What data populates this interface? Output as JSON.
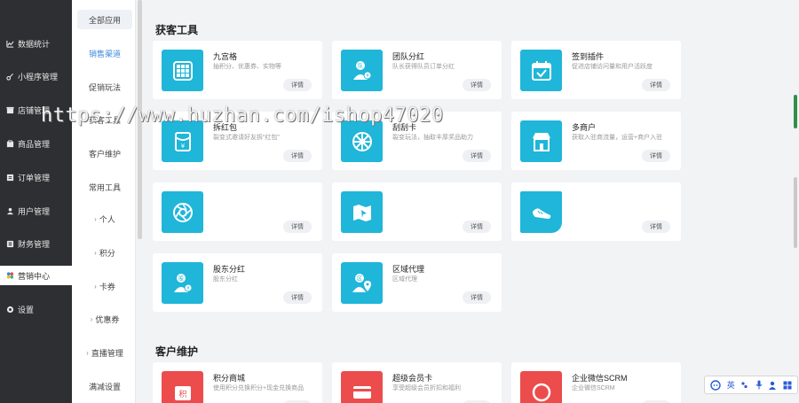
{
  "sidebar": {
    "items": [
      {
        "icon": "chart-icon",
        "glyph": "📈",
        "label": "数据统计"
      },
      {
        "icon": "link-icon",
        "glyph": "⚲",
        "label": "小程序管理"
      },
      {
        "icon": "store-icon",
        "glyph": "▣",
        "label": "店铺管理"
      },
      {
        "icon": "goods-icon",
        "glyph": "▤",
        "label": "商品管理"
      },
      {
        "icon": "order-icon",
        "glyph": "▥",
        "label": "订单管理"
      },
      {
        "icon": "user-icon",
        "glyph": "●",
        "label": "用户管理"
      },
      {
        "icon": "finance-icon",
        "glyph": "▦",
        "label": "财务管理"
      },
      {
        "icon": "marketing-icon",
        "glyph": "✿",
        "label": "营销中心"
      },
      {
        "icon": "settings-icon",
        "glyph": "◉",
        "label": "设置"
      }
    ]
  },
  "subnav": {
    "items": [
      {
        "label": "全部应用",
        "arrow": false
      },
      {
        "label": "销售渠道",
        "arrow": false
      },
      {
        "label": "促销玩法",
        "arrow": false
      },
      {
        "label": "获客工具",
        "arrow": false
      },
      {
        "label": "客户维护",
        "arrow": false
      },
      {
        "label": "常用工具",
        "arrow": false
      },
      {
        "label": "个人",
        "arrow": true
      },
      {
        "label": "积分",
        "arrow": true
      },
      {
        "label": "卡券",
        "arrow": true
      },
      {
        "label": "优惠券",
        "arrow": true
      },
      {
        "label": "直播管理",
        "arrow": true
      },
      {
        "label": "满减设置",
        "arrow": false
      }
    ]
  },
  "sections": [
    {
      "title": "获客工具",
      "cards": [
        {
          "name": "九宫格",
          "desc": "抽积分、优惠券、实物等",
          "button": "详情",
          "icon": "grid-icon"
        },
        {
          "name": "团队分红",
          "desc": "队长获得队员订单分红",
          "button": "详情",
          "icon": "team-bonus-icon"
        },
        {
          "name": "签到插件",
          "desc": "促进店铺访问量和用户活跃度",
          "button": "详情",
          "icon": "calendar-check-icon"
        },
        {
          "name": "拆红包",
          "desc": "裂变式邀请好友拆“红包”",
          "button": "详情",
          "icon": "red-packet-icon"
        },
        {
          "name": "刮刮卡",
          "desc": "裂变玩法，抽取丰厚奖品助力",
          "button": "详情",
          "icon": "wheel-icon"
        },
        {
          "name": "多商户",
          "desc": "获取入驻商流量，运营+商户入驻",
          "button": "详情",
          "icon": "shop-icon"
        },
        {
          "name": "",
          "desc": "",
          "button": "详情",
          "icon": "aperture-icon"
        },
        {
          "name": "",
          "desc": "",
          "button": "详情",
          "icon": "map-icon"
        },
        {
          "name": "",
          "desc": "",
          "button": "详情",
          "icon": "shoe-icon"
        },
        {
          "name": "股东分红",
          "desc": "股东分红",
          "button": "详情",
          "icon": "shareholder-icon"
        },
        {
          "name": "区域代理",
          "desc": "区域代理",
          "button": "详情",
          "icon": "location-agent-icon"
        }
      ]
    },
    {
      "title": "客户维护",
      "cards": [
        {
          "name": "积分商城",
          "desc": "使用积分兑换积分+现金兑换商品",
          "button": "详情",
          "icon": "points-mall-icon"
        },
        {
          "name": "超级会员卡",
          "desc": "享受超级会员折扣和福利",
          "button": "详情",
          "icon": "vip-card-icon"
        },
        {
          "name": "企业微信SCRM",
          "desc": "企业微信SCRM",
          "button": "详情",
          "icon": "scrm-icon"
        }
      ]
    }
  ],
  "watermark": "https://www.huzhan.com/ishop47020",
  "ime": {
    "lang": "英"
  },
  "colors": {
    "sidebar_bg": "#2e2f32",
    "tile_blue": "#1fb6d9",
    "tile_red": "#ec4c4c",
    "link_blue": "#3a88d8"
  }
}
